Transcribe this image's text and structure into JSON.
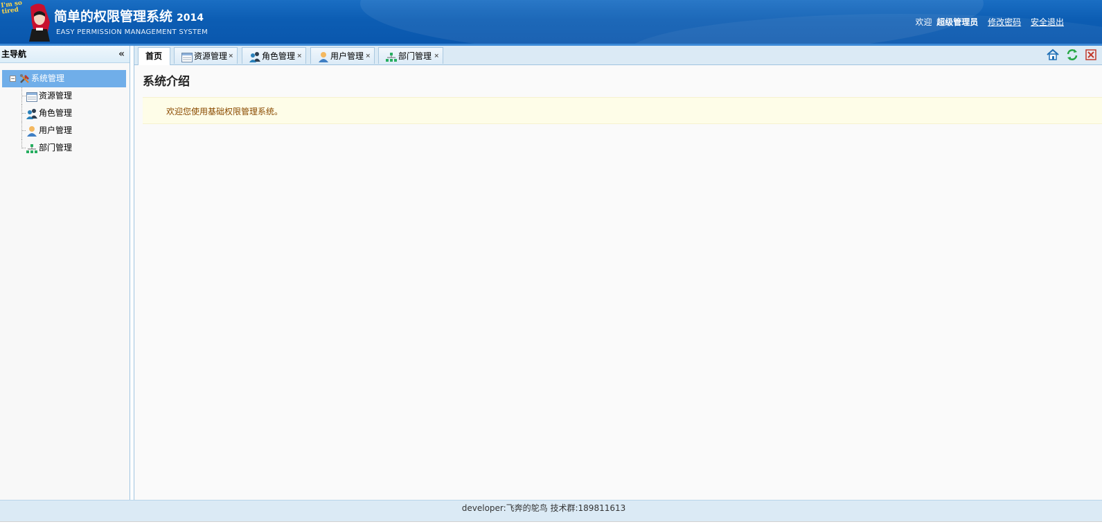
{
  "header": {
    "logo_badge": "I'm so tired",
    "title": "简单的权限管理系统",
    "year": "2014",
    "subtitle": "EASY PERMISSION MANAGEMENT SYSTEM",
    "welcome_prefix": "欢迎",
    "username": "超级管理员",
    "change_password": "修改密码",
    "logout": "安全退出"
  },
  "west": {
    "title": "主导航",
    "collapse_glyph": "«",
    "tree": {
      "root": {
        "label": "系统管理",
        "icon": "tools-icon",
        "toggle": "−"
      },
      "children": [
        {
          "label": "资源管理",
          "icon": "resource-icon"
        },
        {
          "label": "角色管理",
          "icon": "role-icon"
        },
        {
          "label": "用户管理",
          "icon": "user-icon"
        },
        {
          "label": "部门管理",
          "icon": "department-icon"
        }
      ]
    }
  },
  "tabs": [
    {
      "label": "首页",
      "active": true,
      "closable": false
    },
    {
      "label": "资源管理",
      "icon": "resource-icon",
      "closable": true
    },
    {
      "label": "角色管理",
      "icon": "role-icon",
      "closable": true
    },
    {
      "label": "用户管理",
      "icon": "user-icon",
      "closable": true
    },
    {
      "label": "部门管理",
      "icon": "department-icon",
      "closable": true
    }
  ],
  "tab_close_glyph": "×",
  "tab_tools": [
    "home-icon",
    "refresh-icon",
    "close-all-icon"
  ],
  "content": {
    "title": "系统介绍",
    "welcome": "欢迎您使用基础权限管理系统。"
  },
  "footer": {
    "text": "developer:飞奔的鸵鸟 技术群:189811613"
  },
  "colors": {
    "header": "#0c5db3",
    "tree_selected": "#70aee9",
    "tab_bar": "#dbeaf5",
    "welcome_bg": "#fefde8",
    "welcome_text": "#8a4a00"
  }
}
